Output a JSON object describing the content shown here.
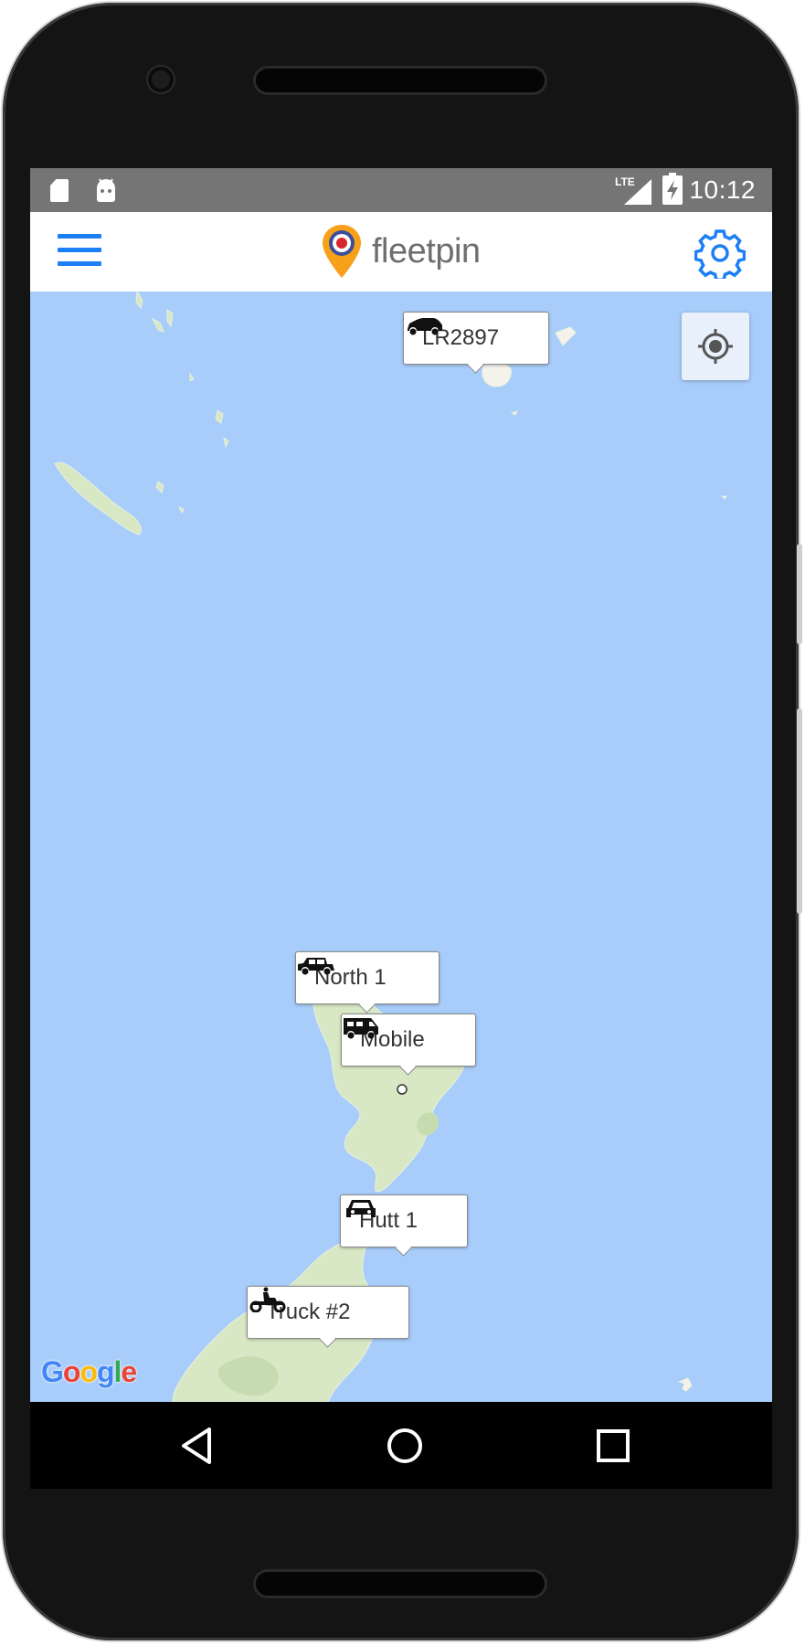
{
  "status_bar": {
    "time": "10:12",
    "network": "LTE",
    "icons": [
      "sd-card-icon",
      "android-icon",
      "signal-icon",
      "battery-charging-icon"
    ]
  },
  "header": {
    "brand": "fleetpin",
    "menu_icon": "hamburger-menu-icon",
    "settings_icon": "gear-icon",
    "colors": {
      "accent": "#1c7ff3",
      "brand_text": "#6e6e6e",
      "logo_pin": "#f7a11a"
    }
  },
  "map": {
    "background_color": "#a8cdfb",
    "land_color": "#d8e8c4",
    "locate_icon": "crosshair-icon",
    "attribution": "Google",
    "markers": [
      {
        "label": "LR2897",
        "icon": "suv-icon"
      },
      {
        "label": "North 1",
        "icon": "jeep-icon"
      },
      {
        "label": "Mobile",
        "icon": "campervan-icon"
      },
      {
        "label": "Hutt 1",
        "icon": "car-icon"
      },
      {
        "label": "Truck #2",
        "icon": "quad-bike-icon"
      }
    ]
  },
  "nav_bar": {
    "buttons": [
      "back-icon",
      "home-icon",
      "recents-icon"
    ]
  }
}
